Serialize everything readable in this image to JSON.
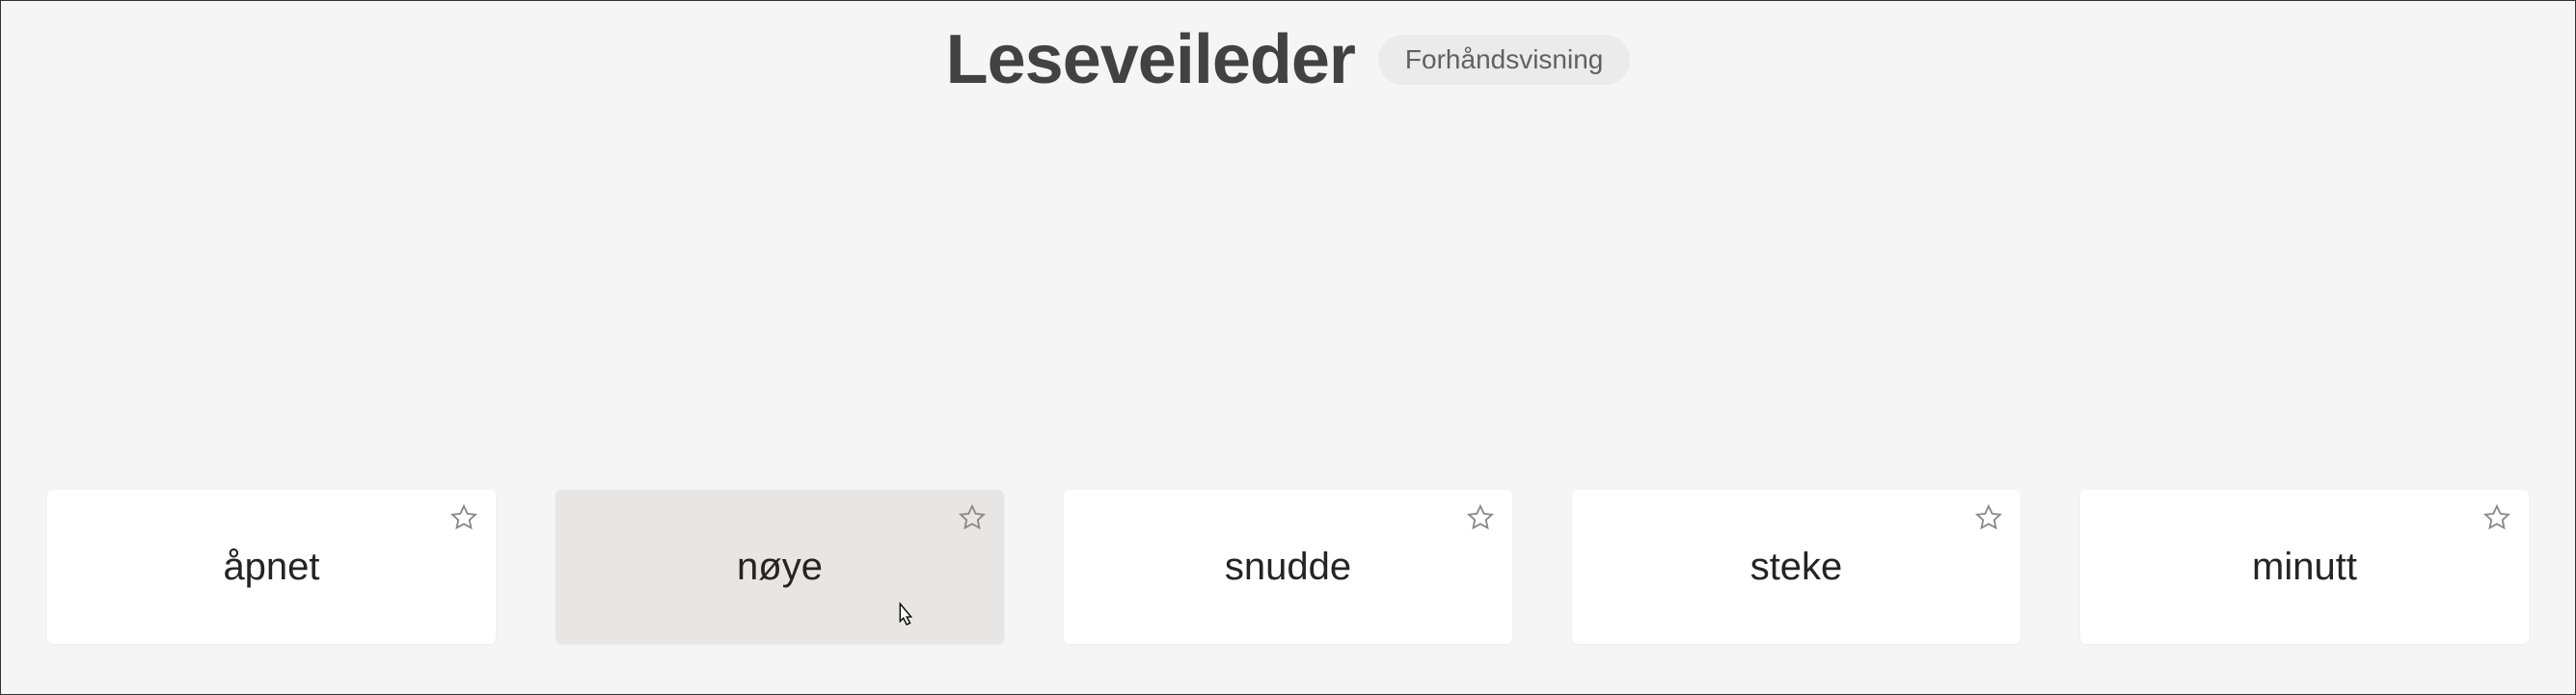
{
  "header": {
    "title": "Leseveileder",
    "badge": "Forhåndsvisning"
  },
  "cards": [
    {
      "word": "åpnet",
      "hovered": false
    },
    {
      "word": "nøye",
      "hovered": true
    },
    {
      "word": "snudde",
      "hovered": false
    },
    {
      "word": "steke",
      "hovered": false
    },
    {
      "word": "minutt",
      "hovered": false
    }
  ],
  "cursor": {
    "visible": true,
    "cardIndex": 1
  }
}
